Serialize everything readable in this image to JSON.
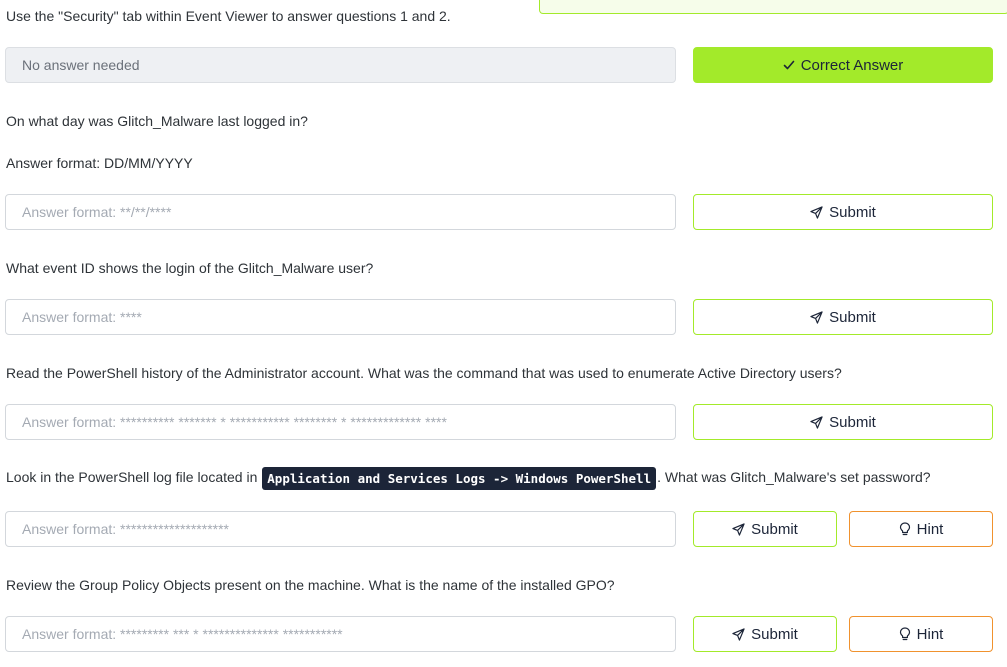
{
  "intro": {
    "text": "Use the \"Security\" tab within Event Viewer to answer questions 1 and 2."
  },
  "questions": [
    {
      "value": "No answer needed",
      "button_label": "Correct Answer"
    },
    {
      "text": "On what day was Glitch_Malware last logged in?",
      "format_note": "Answer format: DD/MM/YYYY",
      "placeholder": "Answer format: **/**/****",
      "submit_label": "Submit"
    },
    {
      "text": "What event ID shows the login of the Glitch_Malware user?",
      "placeholder": "Answer format: ****",
      "submit_label": "Submit"
    },
    {
      "text": "Read the PowerShell history of the Administrator account. What was the command that was used to enumerate Active Directory users?",
      "placeholder": "Answer format: ********** ******* * *********** ******** * ************* ****",
      "submit_label": "Submit"
    },
    {
      "text_before": "Look in the PowerShell log file located in",
      "code": "Application and Services Logs -> Windows PowerShell",
      "text_after": ". What was Glitch_Malware's set password?",
      "placeholder": "Answer format: ********************",
      "submit_label": "Submit",
      "hint_label": "Hint"
    },
    {
      "text": "Review the Group Policy Objects present on the machine. What is the name of the installed GPO?",
      "placeholder": "Answer format: ********* *** * ************** ***********",
      "submit_label": "Submit",
      "hint_label": "Hint"
    }
  ],
  "icons": {
    "check": "check-icon",
    "send": "paper-plane-icon",
    "hint": "lightbulb-icon"
  },
  "colors": {
    "accent_green": "#a3ea2a",
    "hint_orange": "#f0922e",
    "code_bg": "#1c2538"
  }
}
